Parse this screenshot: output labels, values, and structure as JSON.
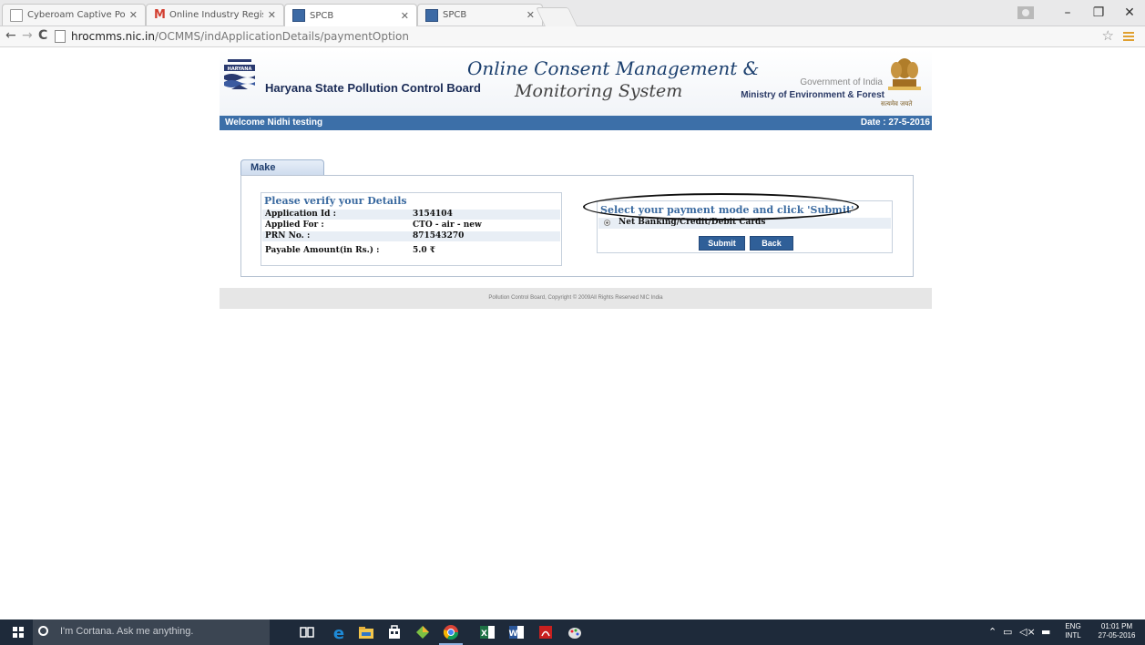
{
  "browser": {
    "tabs": [
      {
        "title": "Cyberoam Captive Portal",
        "icon": "page-icon",
        "active": false
      },
      {
        "title": "Online Industry Registrat",
        "icon": "gmail-icon",
        "active": false
      },
      {
        "title": "SPCB",
        "icon": "spcb-icon",
        "active": true
      },
      {
        "title": "SPCB",
        "icon": "spcb-icon",
        "active": false
      }
    ],
    "url_host": "hrocmms.nic.in",
    "url_path": "/OCMMS/indApplicationDetails/paymentOption"
  },
  "header": {
    "board_name": "Haryana State Pollution Control Board",
    "logo_caption": "HARYANA",
    "system_title_line1": "Online Consent Management &",
    "system_title_line2": "Monitoring System",
    "gov_label": "Government of India",
    "ministry_label": "Ministry of Environment & Forest",
    "emblem_caption": "सत्यमेव जयते"
  },
  "welcome_bar": {
    "welcome_text": "Welcome Nidhi testing",
    "date_text": "Date : 27-5-2016"
  },
  "payment": {
    "tab_label": "Make Payment",
    "details_heading": "Please verify your Details",
    "details": [
      {
        "label": "Application Id :",
        "value": "3154104"
      },
      {
        "label": "Applied For :",
        "value": "CTO - air - new"
      },
      {
        "label": "PRN No. :",
        "value": "871543270"
      },
      {
        "label": "Payable Amount(in Rs.) :",
        "value": "5.0 ₹"
      }
    ],
    "mode_heading": "Select your payment mode and click 'Submit'",
    "mode_option": "Net Banking/Credit/Debit Cards",
    "submit_label": "Submit",
    "back_label": "Back"
  },
  "footer": {
    "text": "Pollution Control Board, Copyright © 2009All Rights Reserved NIC India"
  },
  "taskbar": {
    "search_placeholder": "I'm Cortana. Ask me anything.",
    "lang_line1": "ENG",
    "lang_line2": "INTL",
    "time": "01:01 PM",
    "date": "27-05-2016"
  },
  "colors": {
    "accent_blue": "#3c6fa8",
    "button_blue": "#2f5f98",
    "heading_blue": "#3a6aa0",
    "taskbar": "#1e2a3a"
  }
}
